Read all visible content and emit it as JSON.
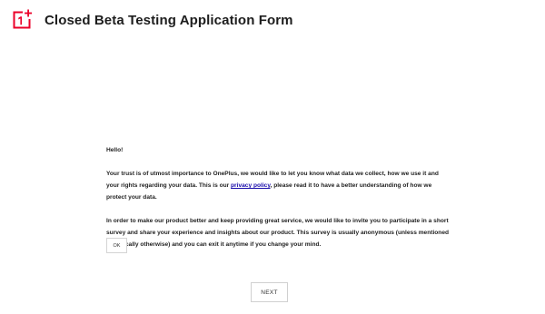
{
  "header": {
    "logo_icon": "oneplus-logo",
    "logo_text": "1+",
    "title": "Closed Beta Testing Application Form"
  },
  "intro": {
    "greeting": "Hello!",
    "paragraph1_before_link": "Your trust is of utmost importance to OnePlus, we would like to let you know what data we collect, how we use it and your rights regarding your data. This is our ",
    "privacy_link": "privacy policy",
    "paragraph1_after_link": ", please read it to have a better understanding of how we protect your data.",
    "paragraph2": "In order to make our product better and keep providing great service, we would like to invite you to participate in a short survey and share your experience and insights about our product. This survey is usually anonymous (unless mentioned specifically otherwise) and you can exit it anytime if you change your mind."
  },
  "buttons": {
    "ok_label": "OK",
    "next_label": "NEXT"
  },
  "colors": {
    "brand_red": "#eb0029",
    "link_blue": "#1a0dab"
  }
}
